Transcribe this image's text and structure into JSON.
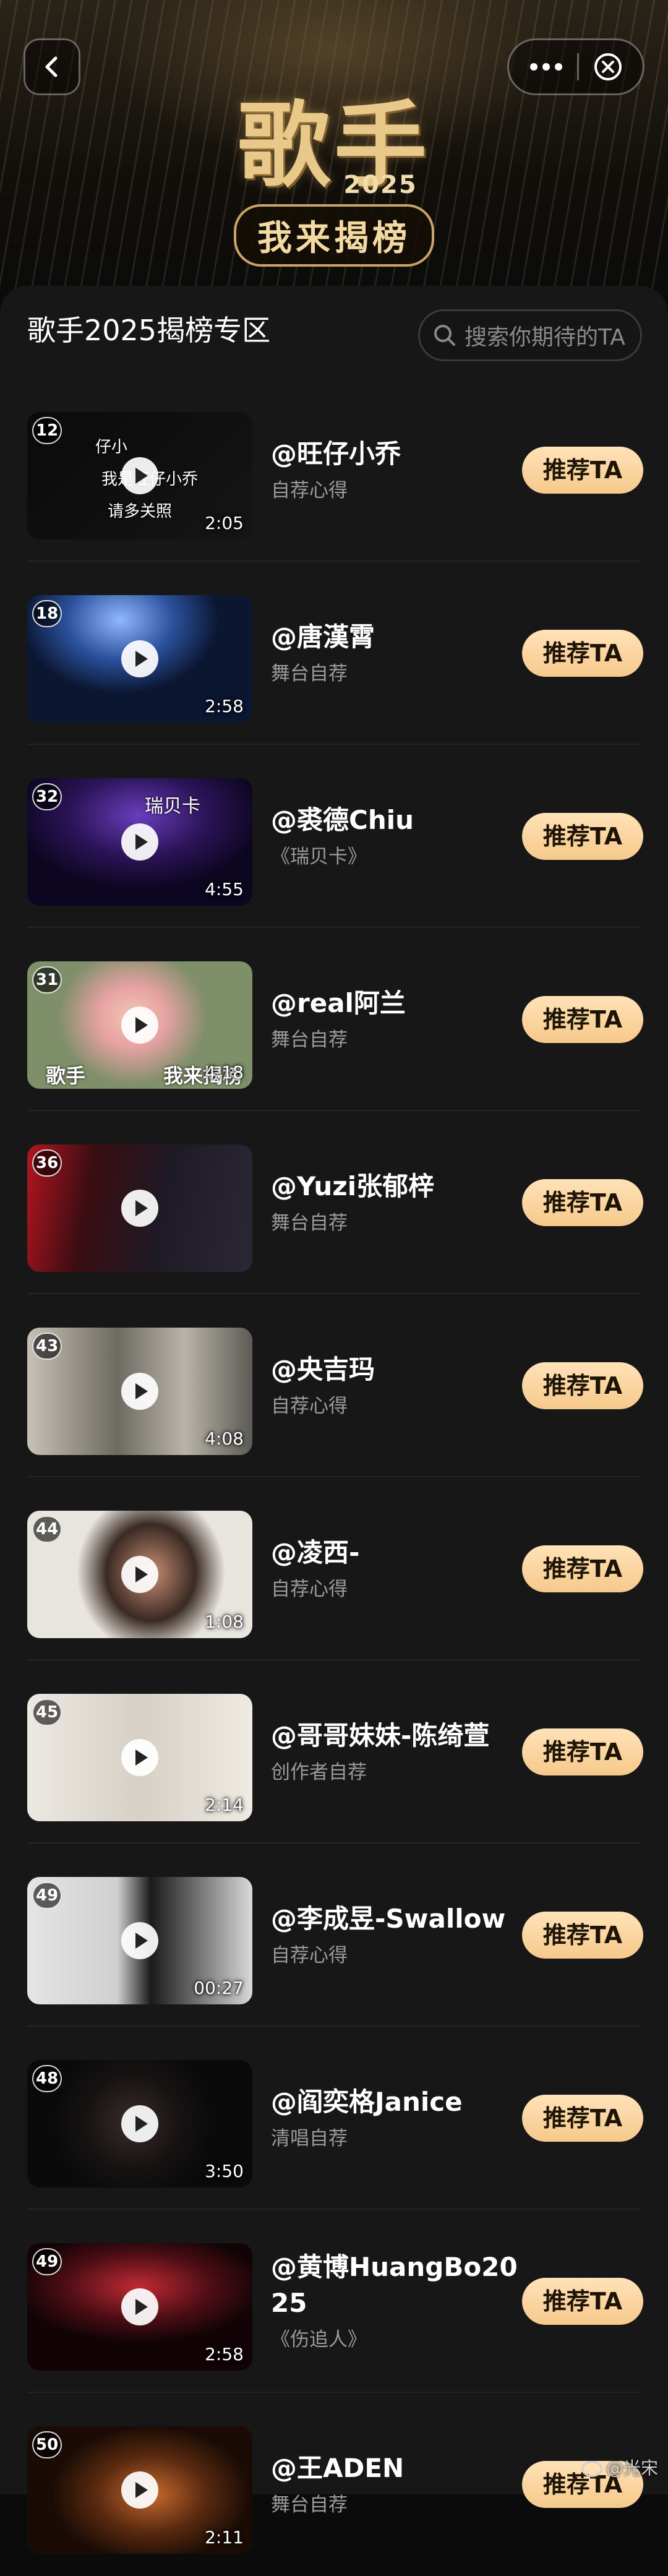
{
  "nav": {
    "back_icon": "chevron-left-icon",
    "more_icon": "more-dots-icon",
    "close_icon": "close-circle-icon"
  },
  "banner": {
    "title": "歌手",
    "year": "2025",
    "subtitle": "我来揭榜"
  },
  "header": {
    "zone_title": "歌手2025揭榜专区",
    "search_placeholder": "搜索你期待的TA"
  },
  "rec_label": "推荐TA",
  "entries": [
    {
      "rank": "12",
      "duration": "2:05",
      "name": "@旺仔小乔",
      "desc": "自荐心得",
      "thumb_text": [
        "仔小",
        "我是旺仔小乔",
        "请多关照"
      ]
    },
    {
      "rank": "18",
      "duration": "2:58",
      "name": "@唐漢霄",
      "desc": "舞台自荐"
    },
    {
      "rank": "32",
      "duration": "4:55",
      "name": "@裘德Chiu",
      "desc": "《瑞贝卡》",
      "thumb_text": [
        "瑞贝卡"
      ]
    },
    {
      "rank": "31",
      "duration": "4:18",
      "name": "@real阿兰",
      "desc": "舞台自荐",
      "thumb_text": [
        "歌手",
        "我来揭榜"
      ]
    },
    {
      "rank": "36",
      "duration": "",
      "name": "@Yuzi张郁梓",
      "desc": "舞台自荐"
    },
    {
      "rank": "43",
      "duration": "4:08",
      "name": "@央吉玛",
      "desc": "自荐心得"
    },
    {
      "rank": "44",
      "duration": "1:08",
      "name": "@凌西-",
      "desc": "自荐心得"
    },
    {
      "rank": "45",
      "duration": "2:14",
      "name": "@哥哥妹妹-陈绮萱",
      "desc": "创作者自荐"
    },
    {
      "rank": "49",
      "duration": "00:27",
      "name": "@李成昱-Swallow",
      "desc": "自荐心得"
    },
    {
      "rank": "48",
      "duration": "3:50",
      "name": "@阎奕格Janice",
      "desc": "清唱自荐"
    },
    {
      "rank": "49",
      "duration": "2:58",
      "name": "@黄博HuangBo2025",
      "desc": "《伤追人》"
    },
    {
      "rank": "50",
      "duration": "2:11",
      "name": "@王ADEN",
      "desc": "舞台自荐"
    }
  ],
  "watermark": "@光宋",
  "colors": {
    "accent_gold": "#f6c98b",
    "panel_bg": "#171717",
    "page_bg": "#0b0b0b"
  }
}
